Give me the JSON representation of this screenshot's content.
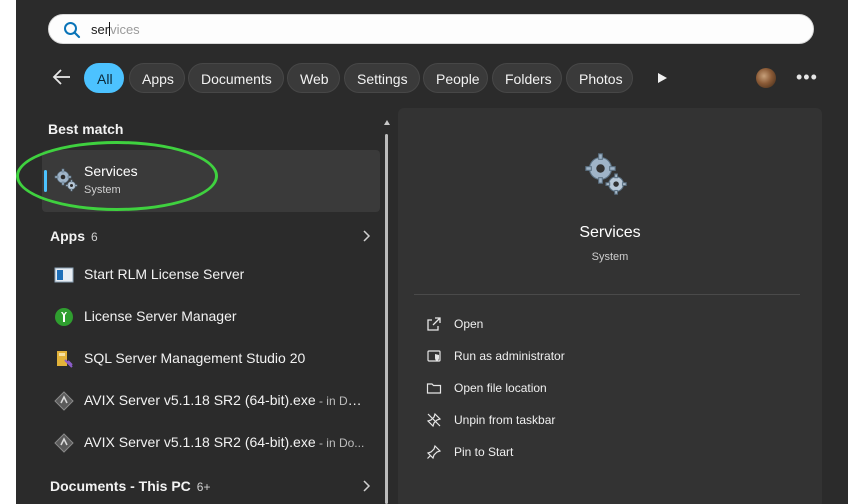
{
  "search": {
    "typed": "ser",
    "suggestion": "vices"
  },
  "filters": [
    {
      "label": "All",
      "active": true
    },
    {
      "label": "Apps",
      "active": false
    },
    {
      "label": "Documents",
      "active": false
    },
    {
      "label": "Web",
      "active": false
    },
    {
      "label": "Settings",
      "active": false
    },
    {
      "label": "People",
      "active": false
    },
    {
      "label": "Folders",
      "active": false
    },
    {
      "label": "Photos",
      "active": false
    }
  ],
  "best_match": {
    "header": "Best match",
    "title": "Services",
    "subtitle": "System"
  },
  "apps": {
    "header": "Apps",
    "count": "6",
    "items": [
      {
        "label": "Start RLM License Server",
        "location": ""
      },
      {
        "label": "License Server Manager",
        "location": ""
      },
      {
        "label": "SQL Server Management Studio 20",
        "location": ""
      },
      {
        "label": "AVIX Server v5.1.18 SR2 (64-bit).exe",
        "location": " - in Des..."
      },
      {
        "label": "AVIX Server v5.1.18 SR2 (64-bit).exe",
        "location": " - in Do..."
      }
    ]
  },
  "documents": {
    "header": "Documents - This PC",
    "count": "6+"
  },
  "detail": {
    "title": "Services",
    "subtitle": "System",
    "actions": [
      {
        "label": "Open",
        "icon": "open-icon"
      },
      {
        "label": "Run as administrator",
        "icon": "shield-icon"
      },
      {
        "label": "Open file location",
        "icon": "folder-icon"
      },
      {
        "label": "Unpin from taskbar",
        "icon": "unpin-icon"
      },
      {
        "label": "Pin to Start",
        "icon": "pin-icon"
      }
    ]
  },
  "colors": {
    "accent": "#4cc2ff",
    "highlight_ring": "#3fd13f",
    "panel": "#2b2b2b"
  }
}
